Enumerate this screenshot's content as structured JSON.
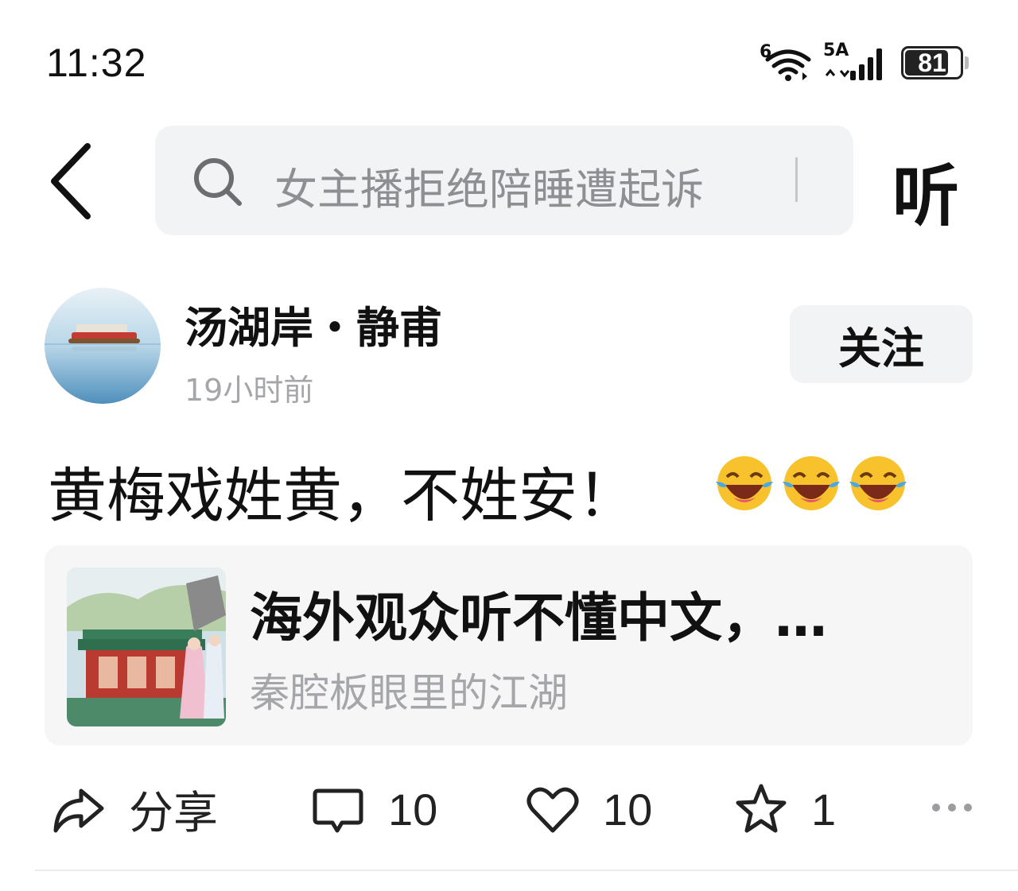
{
  "status_bar": {
    "time": "11:32",
    "wifi_badge": "6",
    "network_badge": "5A",
    "battery": "81",
    "battery_level": 0.81
  },
  "nav": {
    "back_icon": "chevron-left-icon",
    "search_placeholder": "女主播拒绝陪睡遭起诉",
    "listen_label": "听"
  },
  "post": {
    "author_name": "汤湖岸・静甫",
    "time_ago": "19小时前",
    "follow_label": "关注",
    "text": "黄梅戏姓黄，不姓安！",
    "emojis": [
      "laugh-cry-icon",
      "laugh-cry-icon",
      "laugh-cry-icon"
    ],
    "linked_card": {
      "title": "海外观众听不懂中文，…",
      "source": "秦腔板眼里的江湖"
    }
  },
  "actions": {
    "share_label": "分享",
    "comment_count": "10",
    "like_count": "10",
    "favorite_count": "1"
  },
  "colors": {
    "muted_text": "#a4a6aa",
    "search_bg": "#f2f3f5",
    "card_bg": "#f6f6f7"
  }
}
